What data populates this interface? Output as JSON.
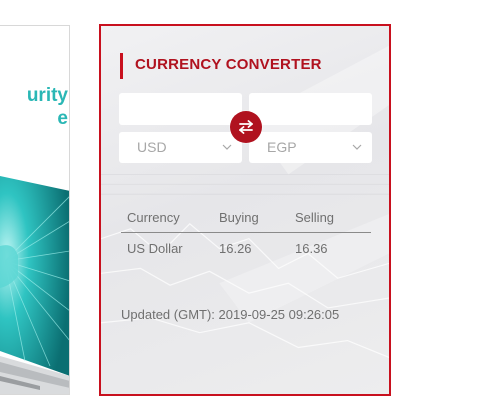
{
  "banner": {
    "title": "urity\ne",
    "accent_color": "#2ab7b5"
  },
  "converter": {
    "title": "CURRENCY CONVERTER",
    "accent_color": "#c8101e",
    "from_amount": "",
    "to_amount": "",
    "from_currency": "USD",
    "to_currency": "EGP",
    "swap_icon": "swap-arrows-icon",
    "dropdown_icon": "chevron-down-icon",
    "table": {
      "headers": [
        "Currency",
        "Buying",
        "Selling"
      ],
      "rows": [
        [
          "US Dollar",
          "16.26",
          "16.36"
        ]
      ]
    },
    "updated": "Updated (GMT): 2019-09-25 09:26:05"
  }
}
